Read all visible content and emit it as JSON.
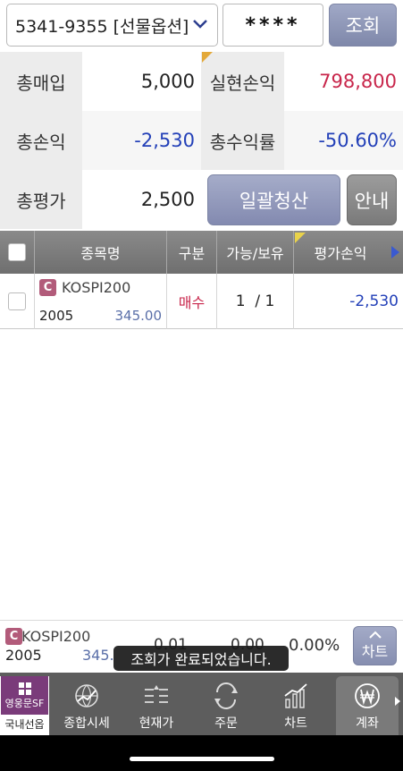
{
  "top": {
    "account": "5341-9355 [선물옵션]",
    "password_mask": "****",
    "query_label": "조회"
  },
  "summary": {
    "total_buy_label": "총매입",
    "total_buy": "5,000",
    "realized_pl_label": "실현손익",
    "realized_pl": "798,800",
    "total_pl_label": "총손익",
    "total_pl": "-2,530",
    "total_return_label": "총수익률",
    "total_return": "-50.60%",
    "total_eval_label": "총평가",
    "total_eval": "2,500",
    "liquidate_all_label": "일괄청산",
    "guide_label": "안내"
  },
  "table": {
    "headers": {
      "item_name": "종목명",
      "side": "구분",
      "avail_hold": "가능/보유",
      "eval_pl": "평가손익"
    },
    "rows": [
      {
        "badge": "C",
        "name": "KOSPI200",
        "code": "2005",
        "price": "345.00",
        "side": "매수",
        "avail_hold": "1  / 1",
        "eval_pl": "-2,530"
      }
    ]
  },
  "ticker": {
    "badge": "C",
    "name": "KOSPI200",
    "code": "2005",
    "price": "345.",
    "v1": "0.01",
    "v2": "0.00",
    "pct": "0.00%",
    "chart_label": "차트"
  },
  "toast": "조회가 완료되었습니다.",
  "nav": {
    "brand_line1": "영웅문SF",
    "domestic_label": "국내선옵",
    "items": [
      "종합시세",
      "현재가",
      "주문",
      "차트",
      "계좌"
    ]
  },
  "colors": {
    "positive": "#c8264b",
    "negative": "#2340b8",
    "button": "#8a91b3"
  }
}
